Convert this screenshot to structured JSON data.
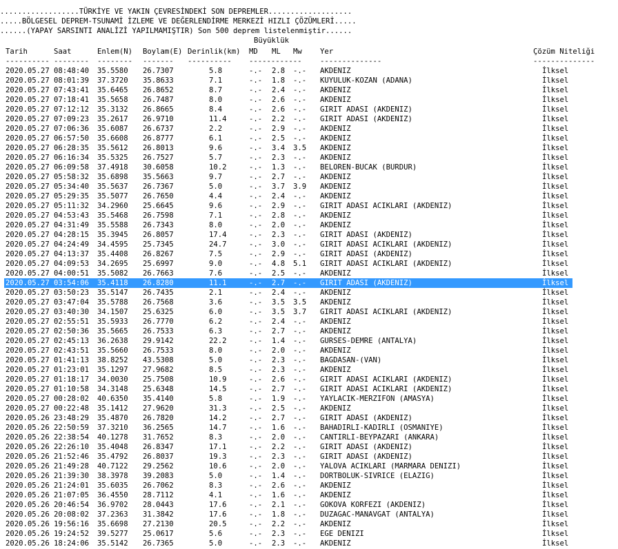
{
  "banner": [
    "..................TÜRKİYE VE YAKIN ÇEVRESİNDEKİ SON DEPREMLER...................",
    ".....BÖLGESEL DEPREM-TSUNAMİ İZLEME VE DEĞERLENDİRME MERKEZİ HIZLI ÇÖZÜMLERİ.....",
    "......(YAPAY SARSINTI ANALİZİ YAPILMAMIŞTIR) Son 500 deprem listelenmiştir......"
  ],
  "headers": {
    "magnitude_group": "Büyüklük",
    "date": "Tarih",
    "time": "Saat",
    "lat": "Enlem(N)",
    "lon": "Boylam(E)",
    "depth": "Derinlik(km)",
    "md": "MD",
    "ml": "ML",
    "mw": "Mw",
    "location": "Yer",
    "quality": "Çözüm Niteliği"
  },
  "separators": {
    "date": "----------",
    "time": "--------",
    "lat": "--------",
    "lon": "-------",
    "depth": "----------",
    "mag": "------------",
    "location": "--------------",
    "quality": "--------------"
  },
  "selected_row_index": 22,
  "rows": [
    [
      "2020.05.27",
      "08:48:40",
      "35.5580",
      "26.7307",
      "5.8",
      "-.-",
      "2.8",
      "-.-",
      "AKDENIZ",
      "İlksel"
    ],
    [
      "2020.05.27",
      "08:01:39",
      "37.3720",
      "35.8633",
      "7.1",
      "-.-",
      "1.8",
      "-.-",
      "KUYULUK-KOZAN (ADANA)",
      "İlksel"
    ],
    [
      "2020.05.27",
      "07:43:41",
      "35.6465",
      "26.8652",
      "8.7",
      "-.-",
      "2.4",
      "-.-",
      "AKDENIZ",
      "İlksel"
    ],
    [
      "2020.05.27",
      "07:18:41",
      "35.5658",
      "26.7487",
      "8.0",
      "-.-",
      "2.6",
      "-.-",
      "AKDENIZ",
      "İlksel"
    ],
    [
      "2020.05.27",
      "07:12:12",
      "35.3132",
      "26.8665",
      "8.4",
      "-.-",
      "2.6",
      "-.-",
      "GIRIT ADASI (AKDENIZ)",
      "İlksel"
    ],
    [
      "2020.05.27",
      "07:09:23",
      "35.2617",
      "26.9710",
      "11.4",
      "-.-",
      "2.2",
      "-.-",
      "GIRIT ADASI (AKDENIZ)",
      "İlksel"
    ],
    [
      "2020.05.27",
      "07:06:36",
      "35.6087",
      "26.6737",
      "2.2",
      "-.-",
      "2.9",
      "-.-",
      "AKDENIZ",
      "İlksel"
    ],
    [
      "2020.05.27",
      "06:57:50",
      "35.6608",
      "26.8777",
      "6.1",
      "-.-",
      "2.5",
      "-.-",
      "AKDENIZ",
      "İlksel"
    ],
    [
      "2020.05.27",
      "06:28:35",
      "35.5612",
      "26.8013",
      "9.6",
      "-.-",
      "3.4",
      "3.5",
      "AKDENIZ",
      "İlksel"
    ],
    [
      "2020.05.27",
      "06:16:34",
      "35.5325",
      "26.7527",
      "5.7",
      "-.-",
      "2.3",
      "-.-",
      "AKDENIZ",
      "İlksel"
    ],
    [
      "2020.05.27",
      "06:09:58",
      "37.4918",
      "30.6058",
      "10.2",
      "-.-",
      "1.3",
      "-.-",
      "BELOREN-BUCAK (BURDUR)",
      "İlksel"
    ],
    [
      "2020.05.27",
      "05:58:32",
      "35.6898",
      "35.5663",
      "9.7",
      "-.-",
      "2.7",
      "-.-",
      "AKDENIZ",
      "İlksel"
    ],
    [
      "2020.05.27",
      "05:34:40",
      "35.5637",
      "26.7367",
      "5.0",
      "-.-",
      "3.7",
      "3.9",
      "AKDENIZ",
      "İlksel"
    ],
    [
      "2020.05.27",
      "05:29:35",
      "35.5077",
      "26.7650",
      "4.4",
      "-.-",
      "2.4",
      "-.-",
      "AKDENIZ",
      "İlksel"
    ],
    [
      "2020.05.27",
      "05:11:32",
      "34.2960",
      "25.6645",
      "9.6",
      "-.-",
      "2.9",
      "-.-",
      "GIRIT ADASI ACIKLARI (AKDENIZ)",
      "İlksel"
    ],
    [
      "2020.05.27",
      "04:53:43",
      "35.5468",
      "26.7598",
      "7.1",
      "-.-",
      "2.8",
      "-.-",
      "AKDENIZ",
      "İlksel"
    ],
    [
      "2020.05.27",
      "04:31:49",
      "35.5588",
      "26.7343",
      "8.0",
      "-.-",
      "2.0",
      "-.-",
      "AKDENIZ",
      "İlksel"
    ],
    [
      "2020.05.27",
      "04:28:15",
      "35.3945",
      "26.8057",
      "17.4",
      "-.-",
      "2.3",
      "-.-",
      "GIRIT ADASI (AKDENIZ)",
      "İlksel"
    ],
    [
      "2020.05.27",
      "04:24:49",
      "34.4595",
      "25.7345",
      "24.7",
      "-.-",
      "3.0",
      "-.-",
      "GIRIT ADASI ACIKLARI (AKDENIZ)",
      "İlksel"
    ],
    [
      "2020.05.27",
      "04:13:37",
      "35.4408",
      "26.8267",
      "7.5",
      "-.-",
      "2.9",
      "-.-",
      "GIRIT ADASI (AKDENIZ)",
      "İlksel"
    ],
    [
      "2020.05.27",
      "04:09:53",
      "34.2695",
      "25.6997",
      "9.0",
      "-.-",
      "4.8",
      "5.1",
      "GIRIT ADASI ACIKLARI (AKDENIZ)",
      "İlksel"
    ],
    [
      "2020.05.27",
      "04:00:51",
      "35.5082",
      "26.7663",
      "7.6",
      "-.-",
      "2.5",
      "-.-",
      "AKDENIZ",
      "İlksel"
    ],
    [
      "2020.05.27",
      "03:54:06",
      "35.4118",
      "26.8280",
      "11.1",
      "-.-",
      "2.7",
      "-.-",
      "GIRIT ADASI (AKDENIZ)",
      "İlksel"
    ],
    [
      "2020.05.27",
      "03:50:23",
      "35.5147",
      "26.7435",
      "2.1",
      "-.-",
      "2.4",
      "-.-",
      "AKDENIZ",
      "İlksel"
    ],
    [
      "2020.05.27",
      "03:47:04",
      "35.5788",
      "26.7568",
      "3.6",
      "-.-",
      "3.5",
      "3.5",
      "AKDENIZ",
      "İlksel"
    ],
    [
      "2020.05.27",
      "03:40:30",
      "34.1507",
      "25.6325",
      "6.0",
      "-.-",
      "3.5",
      "3.7",
      "GIRIT ADASI ACIKLARI (AKDENIZ)",
      "İlksel"
    ],
    [
      "2020.05.27",
      "02:55:51",
      "35.5933",
      "26.7770",
      "6.2",
      "-.-",
      "2.4",
      "-.-",
      "AKDENIZ",
      "İlksel"
    ],
    [
      "2020.05.27",
      "02:50:36",
      "35.5665",
      "26.7533",
      "6.3",
      "-.-",
      "2.7",
      "-.-",
      "AKDENIZ",
      "İlksel"
    ],
    [
      "2020.05.27",
      "02:45:13",
      "36.2638",
      "29.9142",
      "22.2",
      "-.-",
      "1.4",
      "-.-",
      "GURSES-DEMRE (ANTALYA)",
      "İlksel"
    ],
    [
      "2020.05.27",
      "02:43:51",
      "35.5660",
      "26.7533",
      "8.0",
      "-.-",
      "2.0",
      "-.-",
      "AKDENIZ",
      "İlksel"
    ],
    [
      "2020.05.27",
      "01:41:13",
      "38.8252",
      "43.5308",
      "5.0",
      "-.-",
      "2.3",
      "-.-",
      "BAGDASAN-(VAN)",
      "İlksel"
    ],
    [
      "2020.05.27",
      "01:23:01",
      "35.1297",
      "27.9682",
      "8.5",
      "-.-",
      "2.3",
      "-.-",
      "AKDENIZ",
      "İlksel"
    ],
    [
      "2020.05.27",
      "01:18:17",
      "34.0030",
      "25.7508",
      "10.9",
      "-.-",
      "2.6",
      "-.-",
      "GIRIT ADASI ACIKLARI (AKDENIZ)",
      "İlksel"
    ],
    [
      "2020.05.27",
      "01:10:58",
      "34.3148",
      "25.6348",
      "14.5",
      "-.-",
      "2.7",
      "-.-",
      "GIRIT ADASI ACIKLARI (AKDENIZ)",
      "İlksel"
    ],
    [
      "2020.05.27",
      "00:28:02",
      "40.6350",
      "35.4140",
      "5.8",
      "-.-",
      "1.9",
      "-.-",
      "YAYLACIK-MERZIFON (AMASYA)",
      "İlksel"
    ],
    [
      "2020.05.27",
      "00:22:48",
      "35.1412",
      "27.9620",
      "31.3",
      "-.-",
      "2.5",
      "-.-",
      "AKDENIZ",
      "İlksel"
    ],
    [
      "2020.05.26",
      "23:48:29",
      "35.4870",
      "26.7820",
      "14.2",
      "-.-",
      "2.7",
      "-.-",
      "GIRIT ADASI (AKDENIZ)",
      "İlksel"
    ],
    [
      "2020.05.26",
      "22:50:59",
      "37.3210",
      "36.2565",
      "14.7",
      "-.-",
      "1.6",
      "-.-",
      "BAHADIRLI-KADIRLI (OSMANIYE)",
      "İlksel"
    ],
    [
      "2020.05.26",
      "22:38:54",
      "40.1278",
      "31.7652",
      "8.3",
      "-.-",
      "2.0",
      "-.-",
      "CANTIRLI-BEYPAZARI (ANKARA)",
      "İlksel"
    ],
    [
      "2020.05.26",
      "22:26:10",
      "35.4048",
      "26.8347",
      "17.1",
      "-.-",
      "2.2",
      "-.-",
      "GIRIT ADASI (AKDENIZ)",
      "İlksel"
    ],
    [
      "2020.05.26",
      "21:52:46",
      "35.4792",
      "26.8037",
      "19.3",
      "-.-",
      "2.3",
      "-.-",
      "GIRIT ADASI (AKDENIZ)",
      "İlksel"
    ],
    [
      "2020.05.26",
      "21:49:28",
      "40.7122",
      "29.2562",
      "10.6",
      "-.-",
      "2.0",
      "-.-",
      "YALOVA ACIKLARI (MARMARA DENIZI)",
      "İlksel"
    ],
    [
      "2020.05.26",
      "21:39:30",
      "38.3978",
      "39.2083",
      "5.0",
      "-.-",
      "1.4",
      "-.-",
      "DORTBOLUK-SIVRICE (ELAZIG)",
      "İlksel"
    ],
    [
      "2020.05.26",
      "21:24:01",
      "35.6035",
      "26.7062",
      "8.3",
      "-.-",
      "2.6",
      "-.-",
      "AKDENIZ",
      "İlksel"
    ],
    [
      "2020.05.26",
      "21:07:05",
      "36.4550",
      "28.7112",
      "4.1",
      "-.-",
      "1.6",
      "-.-",
      "AKDENIZ",
      "İlksel"
    ],
    [
      "2020.05.26",
      "20:46:54",
      "36.9702",
      "28.0443",
      "17.6",
      "-.-",
      "2.1",
      "-.-",
      "GOKOVA KORFEZI (AKDENIZ)",
      "İlksel"
    ],
    [
      "2020.05.26",
      "20:08:02",
      "37.2363",
      "31.3842",
      "17.6",
      "-.-",
      "1.8",
      "-.-",
      "DUZAGAC-MANAVGAT (ANTALYA)",
      "İlksel"
    ],
    [
      "2020.05.26",
      "19:56:16",
      "35.6698",
      "27.2130",
      "20.5",
      "-.-",
      "2.2",
      "-.-",
      "AKDENIZ",
      "İlksel"
    ],
    [
      "2020.05.26",
      "19:24:52",
      "39.5277",
      "25.0617",
      "5.6",
      "-.-",
      "2.3",
      "-.-",
      "EGE DENIZI",
      "İlksel"
    ],
    [
      "2020.05.26",
      "18:24:06",
      "35.5142",
      "26.7365",
      "5.0",
      "-.-",
      "2.3",
      "-.-",
      "AKDENIZ",
      "İlksel"
    ]
  ]
}
